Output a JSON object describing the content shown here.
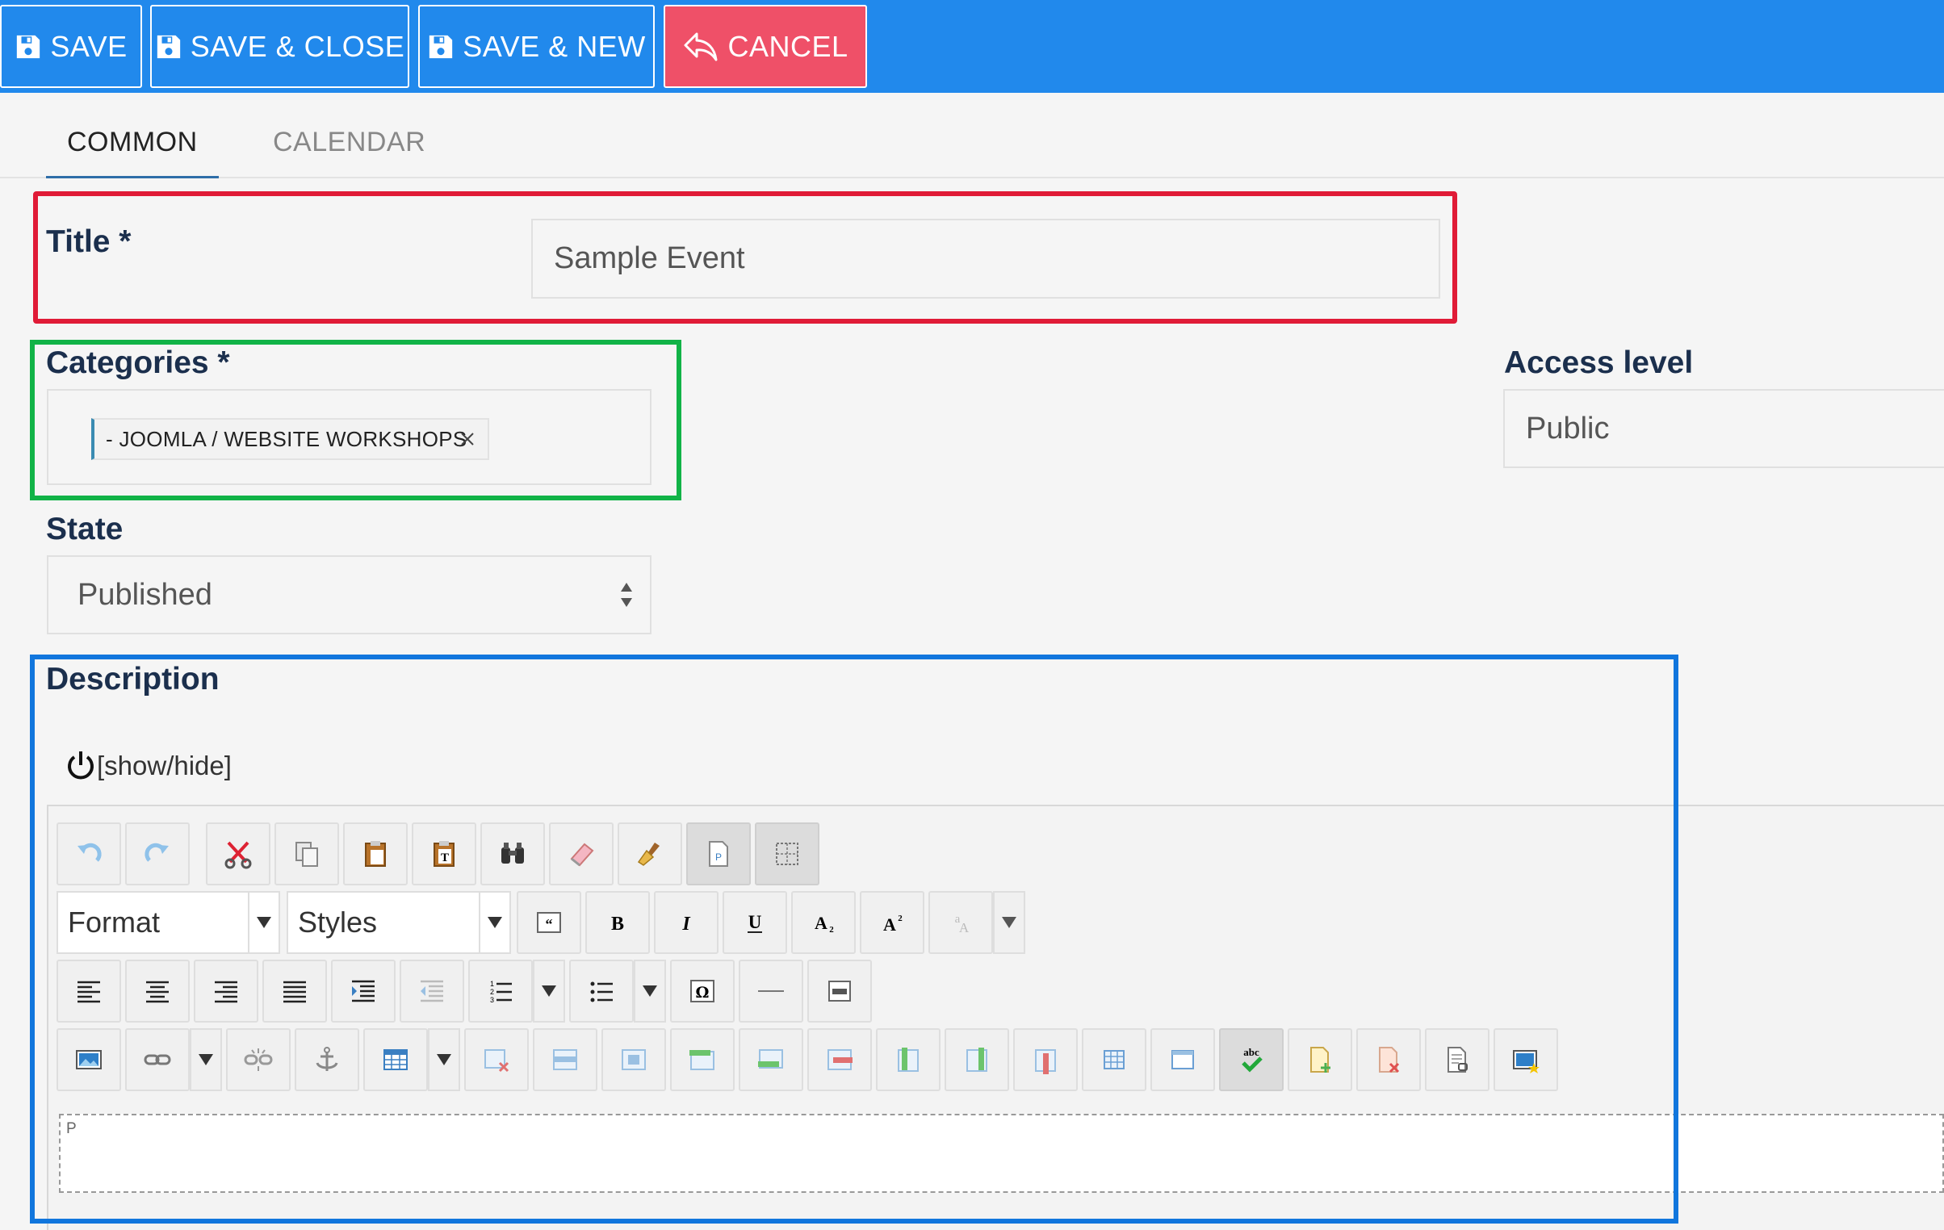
{
  "toolbar": {
    "save": "SAVE",
    "save_close": "SAVE & CLOSE",
    "save_new": "SAVE & NEW",
    "cancel": "CANCEL"
  },
  "tabs": [
    {
      "label": "COMMON",
      "active": true
    },
    {
      "label": "CALENDAR",
      "active": false
    }
  ],
  "form": {
    "title_label": "Title *",
    "title_value": "Sample Event",
    "categories_label": "Categories *",
    "category_chip": "- JOOMLA / WEBSITE WORKSHOPS",
    "access_label": "Access level",
    "access_value": "Public",
    "state_label": "State",
    "state_value": "Published",
    "description_label": "Description",
    "show_hide": "[show/hide]"
  },
  "editor": {
    "format_label": "Format",
    "styles_label": "Styles",
    "paragraph_tag": "P",
    "buttons_row1": [
      "undo-icon",
      "redo-icon",
      "cut-icon",
      "copy-icon",
      "paste-icon",
      "paste-text-icon",
      "find-icon",
      "eraser-icon",
      "clean-up-icon",
      "page-break-icon",
      "show-blocks-icon"
    ],
    "buttons_row3": [
      "align-left-icon",
      "align-center-icon",
      "align-right-icon",
      "align-justify-icon",
      "indent-icon",
      "outdent-icon",
      "ordered-list-icon",
      "unordered-list-icon",
      "special-char-icon",
      "horizontal-rule-icon",
      "pagebreak-icon"
    ],
    "buttons_row4": [
      "image-icon",
      "link-icon",
      "unlink-icon",
      "anchor-icon",
      "table-icon",
      "delete-table-icon",
      "row-before-icon",
      "row-after-icon",
      "insert-row-icon",
      "insert-row-after-icon",
      "delete-row-icon",
      "col-before-icon",
      "col-after-icon",
      "delete-col-icon",
      "cell-props-icon",
      "merge-cells-icon",
      "spellcheck-icon",
      "add-page-icon",
      "delete-page-icon",
      "template-icon",
      "media-icon"
    ]
  },
  "colors": {
    "toolbar_bg": "#2189ec",
    "cancel_bg": "#ef5068",
    "annotation_red": "#e01b37",
    "annotation_green": "#11b347",
    "annotation_blue": "#1176dd",
    "label_color": "#1b2f4d"
  }
}
